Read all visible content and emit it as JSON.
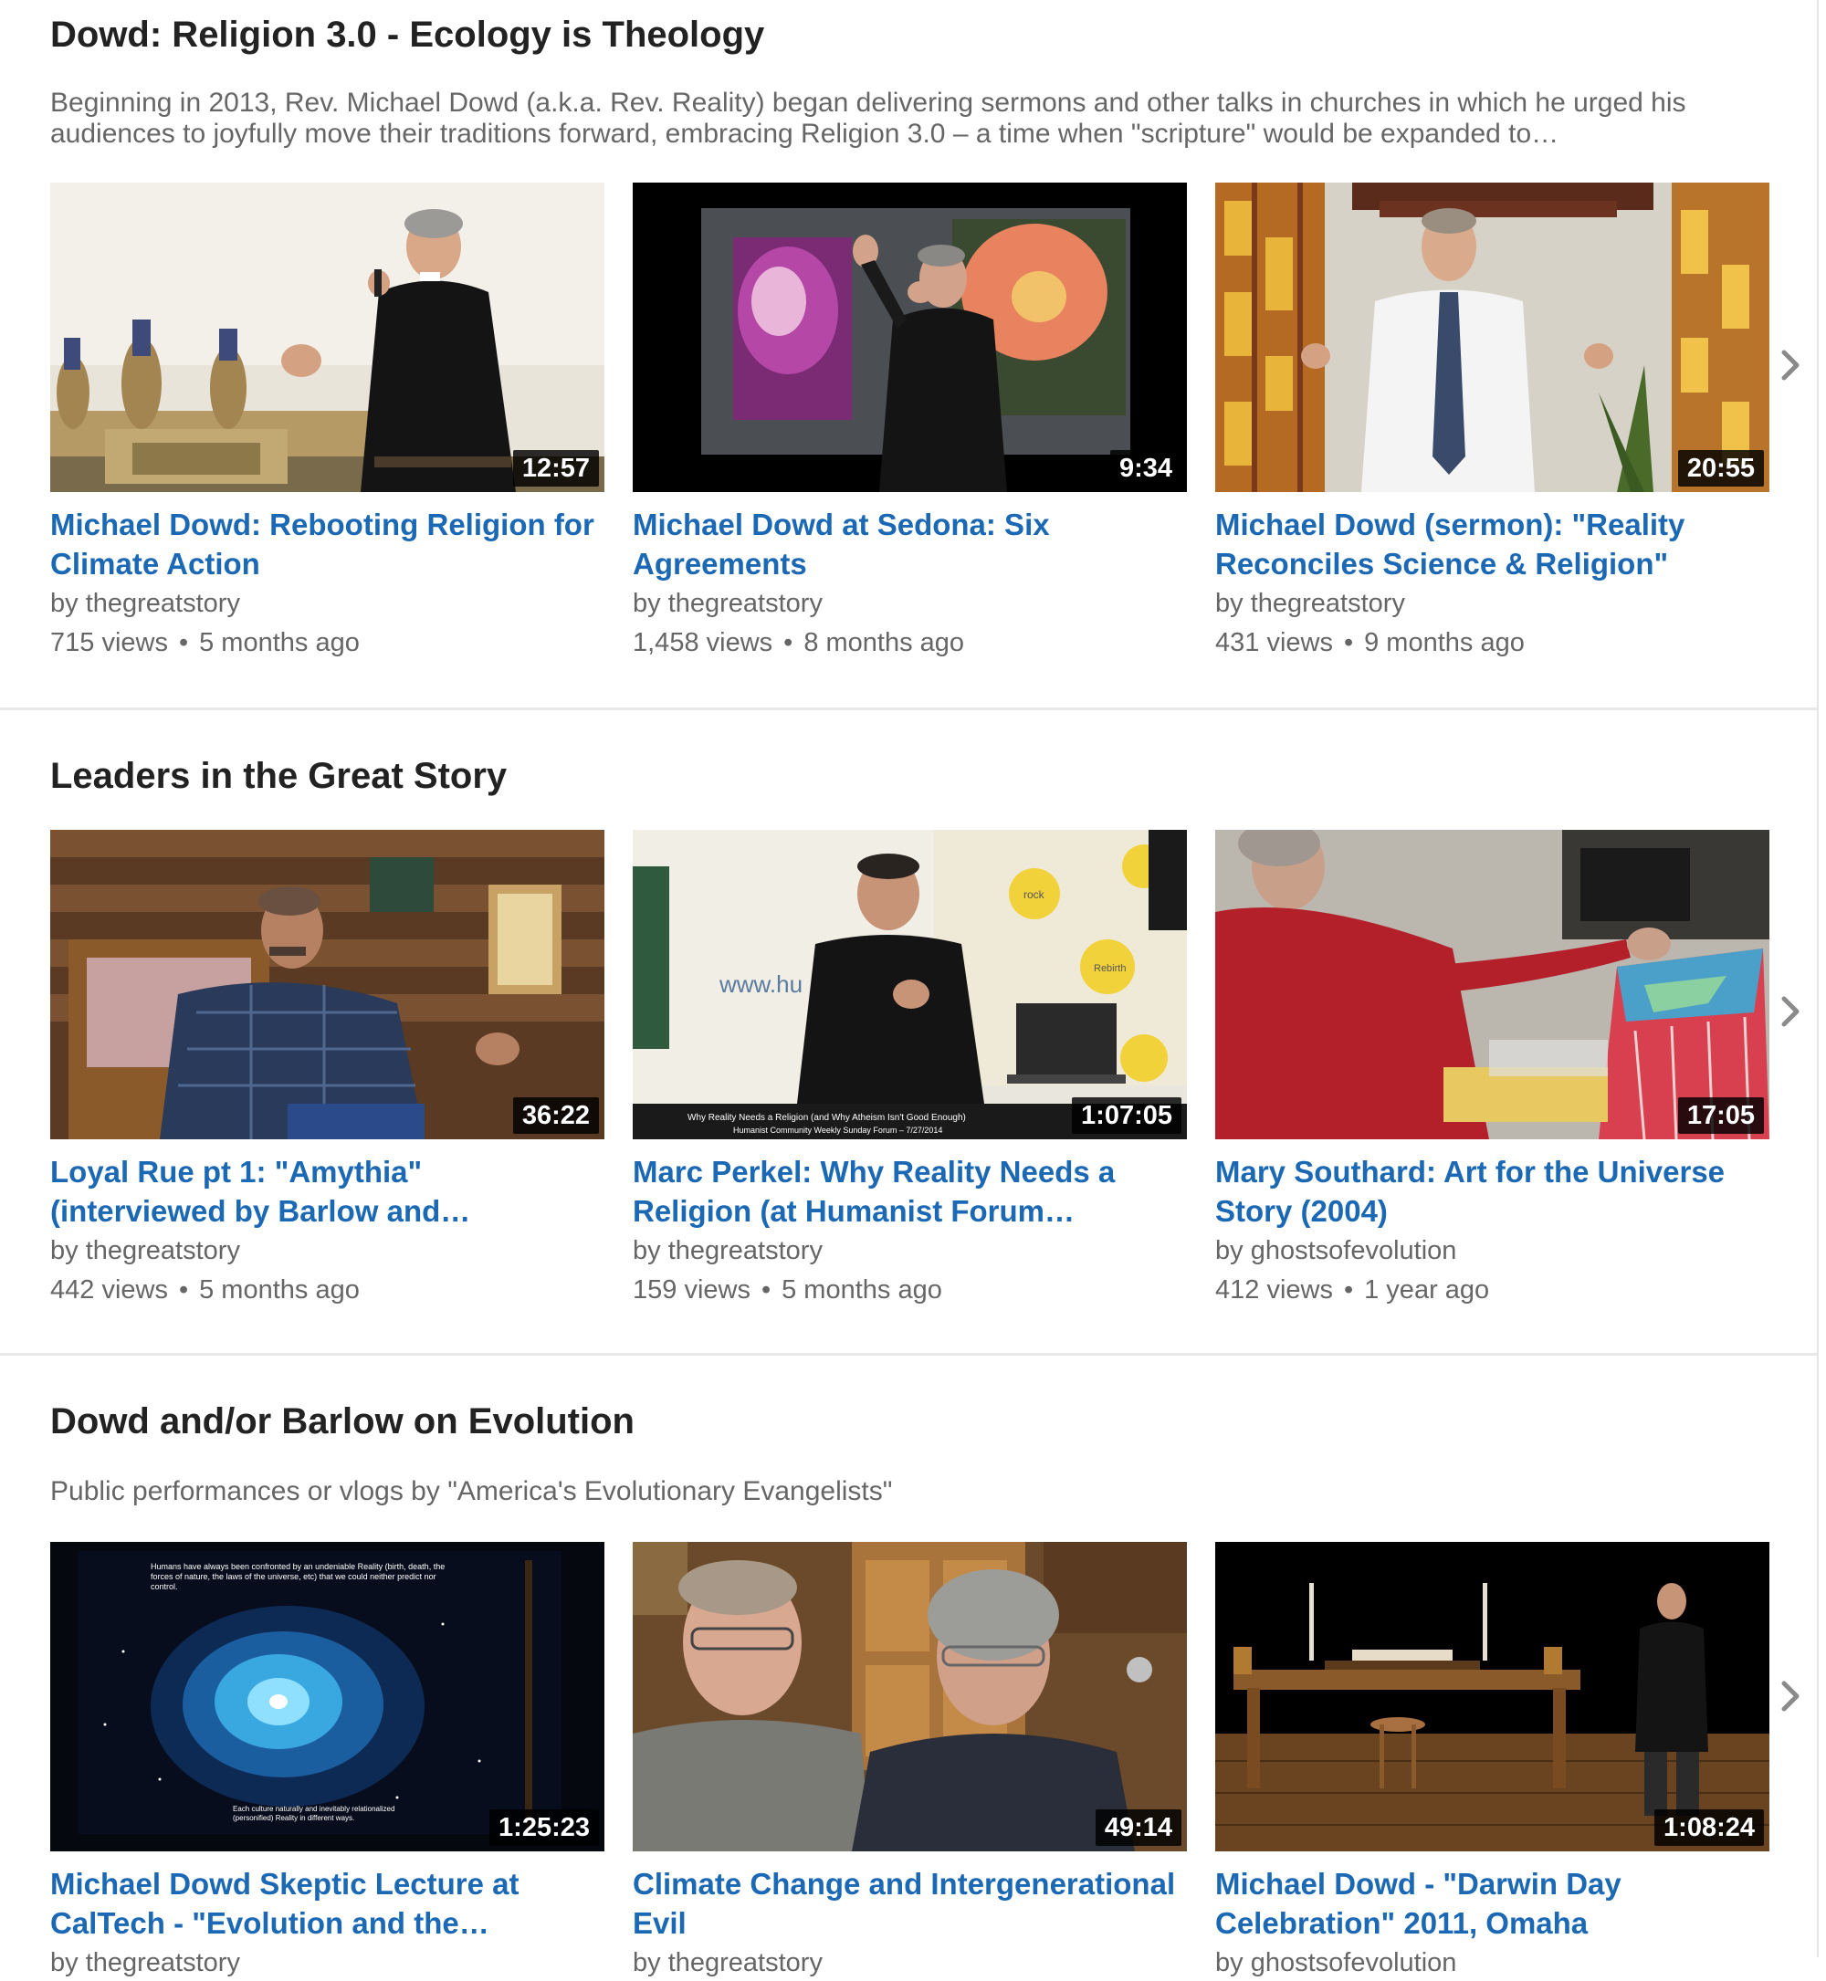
{
  "sections": [
    {
      "title": "Dowd: Religion 3.0 - Ecology is Theology",
      "description": "Beginning in 2013, Rev. Michael Dowd (a.k.a. Rev. Reality) began delivering sermons and other talks in churches in which he urged his audiences to joyfully move their traditions forward, embracing Religion 3.0 – a time when \"scripture\" would be expanded to…",
      "videos": [
        {
          "title": "Michael Dowd: Rebooting Religion for Climate Action",
          "duration": "12:57",
          "by": "by",
          "channel": "thegreatstory",
          "views": "715 views",
          "age": "5 months ago"
        },
        {
          "title": "Michael Dowd at Sedona: Six Agreements",
          "duration": "9:34",
          "by": "by",
          "channel": "thegreatstory",
          "views": "1,458 views",
          "age": "8 months ago"
        },
        {
          "title": "Michael Dowd (sermon): \"Reality Reconciles Science & Religion\"",
          "duration": "20:55",
          "by": "by",
          "channel": "thegreatstory",
          "views": "431 views",
          "age": "9 months ago"
        }
      ]
    },
    {
      "title": "Leaders in the Great Story",
      "description": "",
      "videos": [
        {
          "title": "Loyal Rue pt 1: \"Amythia\" (interviewed by Barlow and…",
          "duration": "36:22",
          "by": "by",
          "channel": "thegreatstory",
          "views": "442 views",
          "age": "5 months ago"
        },
        {
          "title": "Marc Perkel: Why Reality Needs a Religion (at Humanist Forum…",
          "duration": "1:07:05",
          "by": "by",
          "channel": "thegreatstory",
          "views": "159 views",
          "age": "5 months ago",
          "thumb_caption_1": "Why Reality Needs a Religion (and Why Atheism Isn't Good Enough)",
          "thumb_caption_2": "Humanist Community Weekly Sunday Forum – 7/27/2014",
          "thumb_banner": "www.hu",
          "thumb_sticker_1": "rock",
          "thumb_sticker_2": "Rebirth"
        },
        {
          "title": "Mary Southard: Art for the Universe Story (2004)",
          "duration": "17:05",
          "by": "by",
          "channel": "ghostsofevolution",
          "views": "412 views",
          "age": "1 year ago"
        }
      ]
    },
    {
      "title": "Dowd and/or Barlow on Evolution",
      "description": "Public performances or vlogs by \"America's Evolutionary Evangelists\"",
      "videos": [
        {
          "title": "Michael Dowd Skeptic Lecture at CalTech - \"Evolution and the…",
          "duration": "1:25:23",
          "by": "by",
          "channel": "thegreatstory",
          "thumb_text_top": "Humans have always been confronted by an undeniable Reality (birth, death, the forces of nature, the laws of the universe, etc) that we could neither predict nor control.",
          "thumb_text_bottom": "Each culture naturally and inevitably relationalized (personified) Reality in different ways."
        },
        {
          "title": "Climate Change and Intergenerational Evil",
          "duration": "49:14",
          "by": "by",
          "channel": "thegreatstory"
        },
        {
          "title": "Michael Dowd - \"Darwin Day Celebration\" 2011, Omaha",
          "duration": "1:08:24",
          "by": "by",
          "channel": "ghostsofevolution"
        }
      ]
    }
  ],
  "icons": {
    "next_arrow": "chevron-right-icon",
    "separator": "•"
  },
  "colors": {
    "title_link": "#1b68b5",
    "meta_text": "#666666",
    "heading": "#222222",
    "duration_bg": "#000000"
  }
}
